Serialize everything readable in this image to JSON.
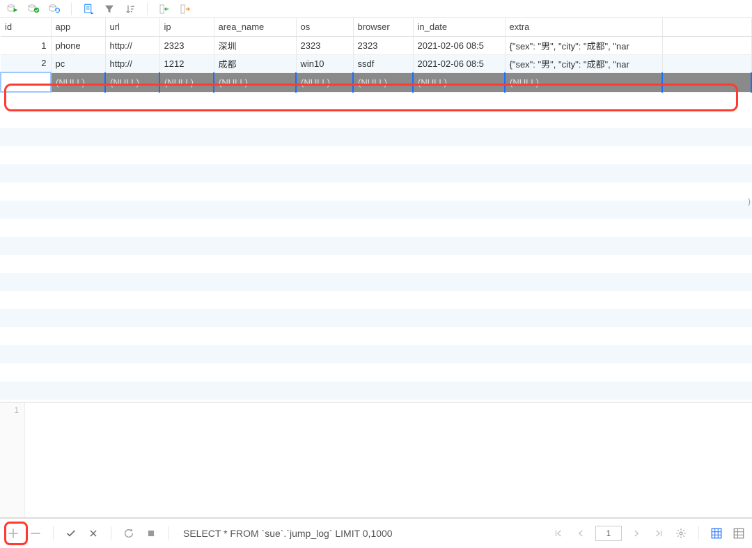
{
  "toolbar_icons": {
    "run": "run-query-icon",
    "commit": "commit-icon",
    "refresh": "refresh-icon",
    "script": "script-icon",
    "filter": "filter-icon",
    "sort": "sort-icon",
    "import": "import-icon",
    "export": "export-icon"
  },
  "columns": [
    {
      "key": "id",
      "label": "id"
    },
    {
      "key": "app",
      "label": "app"
    },
    {
      "key": "url",
      "label": "url"
    },
    {
      "key": "ip",
      "label": "ip"
    },
    {
      "key": "area_name",
      "label": "area_name"
    },
    {
      "key": "os",
      "label": "os"
    },
    {
      "key": "browser",
      "label": "browser"
    },
    {
      "key": "in_date",
      "label": "in_date"
    },
    {
      "key": "extra",
      "label": "extra"
    }
  ],
  "rows": [
    {
      "id": "1",
      "app": "phone",
      "url": "http://",
      "ip": "2323",
      "area_name": "深圳",
      "os": "2323",
      "browser": "2323",
      "in_date": "2021-02-06 08:5",
      "extra": "{\"sex\": \"男\", \"city\": \"成都\", \"nar"
    },
    {
      "id": "2",
      "app": "pc",
      "url": "http://",
      "ip": "1212",
      "area_name": "成都",
      "os": "win10",
      "browser": "ssdf",
      "in_date": "2021-02-06 08:5",
      "extra": "{\"sex\": \"男\", \"city\": \"成都\", \"nar"
    }
  ],
  "null_row": {
    "id": "",
    "cell_text": "(NULL)",
    "ellipsis": "•••"
  },
  "right_marker": ")",
  "editor": {
    "line_number": "1",
    "content": ""
  },
  "bottom": {
    "sql": "SELECT * FROM `sue`.`jump_log` LIMIT 0,1000",
    "page_value": "1",
    "icons": {
      "add": "plus-icon",
      "remove": "minus-icon",
      "apply": "check-icon",
      "cancel": "x-icon",
      "reload": "reload-icon",
      "stop": "stop-icon",
      "first": "first-page-icon",
      "prev": "prev-page-icon",
      "next": "next-page-icon",
      "last": "last-page-icon",
      "settings": "gear-icon",
      "grid_view": "grid-view-icon",
      "form_view": "form-view-icon"
    }
  }
}
